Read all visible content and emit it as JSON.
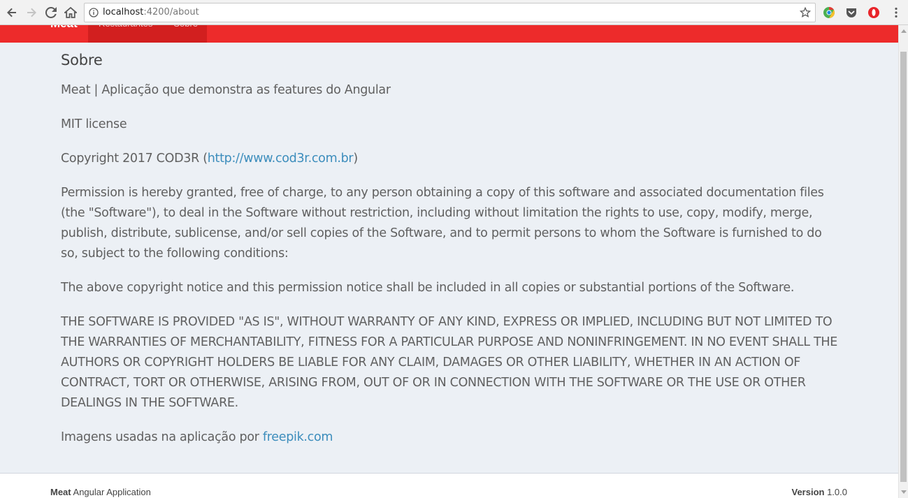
{
  "browser": {
    "url_host": "localhost",
    "url_rest": ":4200/about"
  },
  "app": {
    "brand": "Meat",
    "nav": [
      {
        "label": "Restaurantes"
      },
      {
        "label": "Sobre"
      }
    ],
    "accent_color": "#ed2b2b"
  },
  "about": {
    "title": "Sobre",
    "description": "Meat | Aplicação que demonstra as features do Angular",
    "license": "MIT license",
    "copyright_prefix": "Copyright 2017 COD3R (",
    "copyright_link": "http://www.cod3r.com.br",
    "copyright_suffix": ")",
    "permission": "Permission is hereby granted, free of charge, to any person obtaining a copy of this software and associated documentation files (the \"Software\"), to deal in the Software without restriction, including without limitation the rights to use, copy, modify, merge, publish, distribute, sublicense, and/or sell copies of the Software, and to permit persons to whom the Software is furnished to do so, subject to the following conditions:",
    "notice": "The above copyright notice and this permission notice shall be included in all copies or substantial portions of the Software.",
    "warranty": "THE SOFTWARE IS PROVIDED \"AS IS\", WITHOUT WARRANTY OF ANY KIND, EXPRESS OR IMPLIED, INCLUDING BUT NOT LIMITED TO THE WARRANTIES OF MERCHANTABILITY, FITNESS FOR A PARTICULAR PURPOSE AND NONINFRINGEMENT. IN NO EVENT SHALL THE AUTHORS OR COPYRIGHT HOLDERS BE LIABLE FOR ANY CLAIM, DAMAGES OR OTHER LIABILITY, WHETHER IN AN ACTION OF CONTRACT, TORT OR OTHERWISE, ARISING FROM, OUT OF OR IN CONNECTION WITH THE SOFTWARE OR THE USE OR OTHER DEALINGS IN THE SOFTWARE.",
    "images_prefix": "Imagens usadas na aplicação por ",
    "images_link": "freepik.com"
  },
  "footer": {
    "brand": "Meat",
    "app_text": " Angular Application",
    "version_label": "Version",
    "version_value": " 1.0.0"
  }
}
